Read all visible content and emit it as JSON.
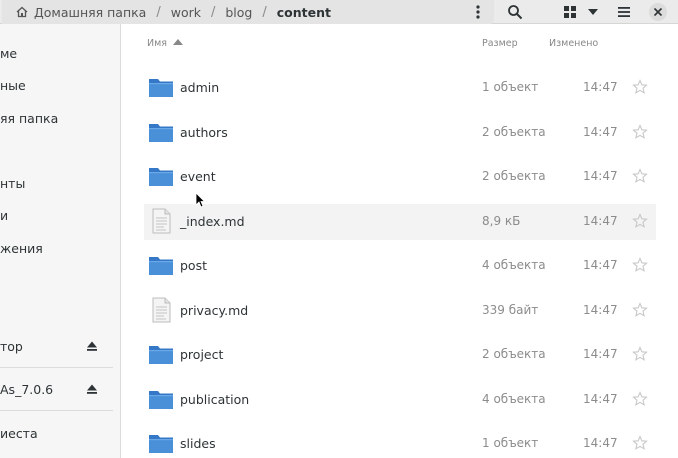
{
  "pathbar": {
    "crumbs": [
      {
        "label": "Домашняя папка"
      },
      {
        "label": "work"
      },
      {
        "label": "blog"
      },
      {
        "label": "content"
      }
    ]
  },
  "toolbar": {
    "search_icon": "search-icon",
    "view_icon": "grid-view-icon",
    "sort_icon": "chevron-down-icon",
    "menu_icon": "hamburger-menu-icon",
    "close_icon": "close-icon"
  },
  "sidebar": {
    "items": [
      {
        "label": "ме"
      },
      {
        "label": "ные"
      },
      {
        "label": "яя папка"
      },
      {
        "label": "нты"
      },
      {
        "label": "и"
      },
      {
        "label": "жения"
      },
      {
        "label": "тор"
      },
      {
        "label": "As_7.0.6"
      },
      {
        "label": "иеста"
      }
    ]
  },
  "columns": {
    "name": "Имя",
    "size": "Размер",
    "modified": "Изменено"
  },
  "files": [
    {
      "name": "admin",
      "type": "folder",
      "size": "1 объект",
      "time": "14:47"
    },
    {
      "name": "authors",
      "type": "folder",
      "size": "2 объекта",
      "time": "14:47"
    },
    {
      "name": "event",
      "type": "folder",
      "size": "2 объекта",
      "time": "14:47"
    },
    {
      "name": "_index.md",
      "type": "file",
      "size": "8,9 кБ",
      "time": "14:47"
    },
    {
      "name": "post",
      "type": "folder",
      "size": "4 объекта",
      "time": "14:47"
    },
    {
      "name": "privacy.md",
      "type": "file",
      "size": "339 байт",
      "time": "14:47"
    },
    {
      "name": "project",
      "type": "folder",
      "size": "2 объекта",
      "time": "14:47"
    },
    {
      "name": "publication",
      "type": "folder",
      "size": "4 объекта",
      "time": "14:47"
    },
    {
      "name": "slides",
      "type": "folder",
      "size": "1 объект",
      "time": "14:47"
    }
  ],
  "colors": {
    "folder": "#4a90d9",
    "folder_tab": "#3578c7",
    "accent": "#2e3436"
  }
}
